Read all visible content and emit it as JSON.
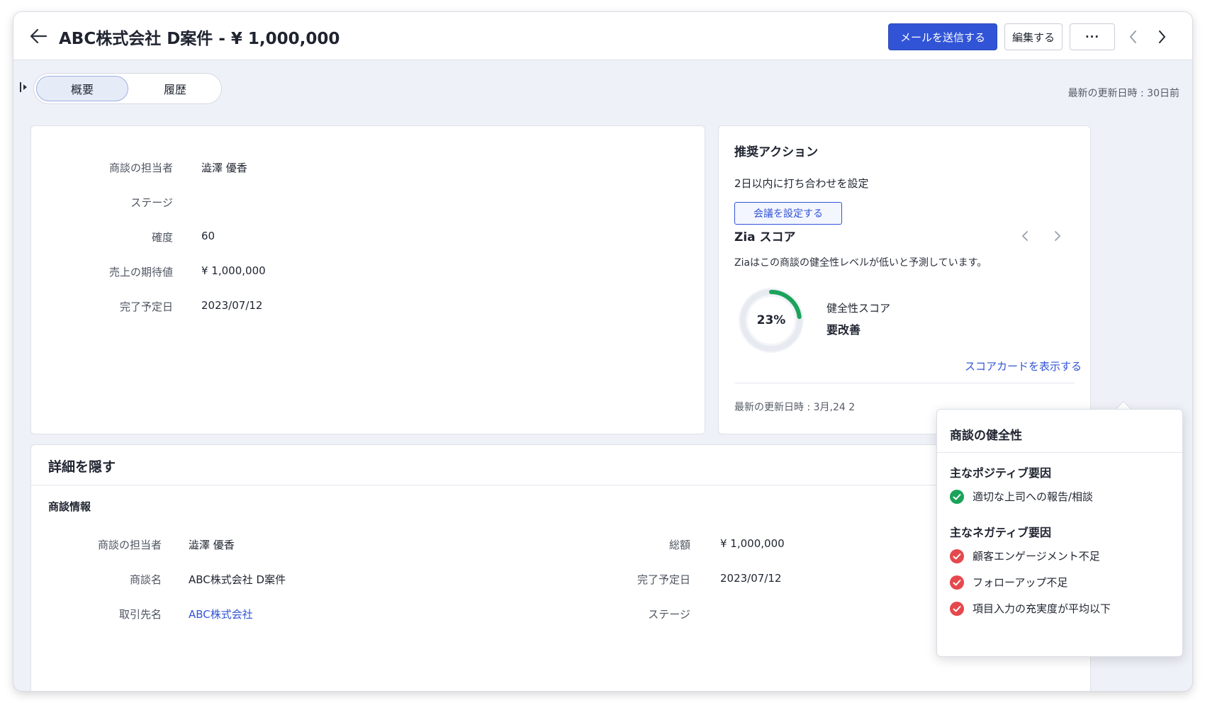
{
  "header": {
    "title": "ABC株式会社 D案件 - ¥ 1,000,000",
    "send_mail": "メールを送信する",
    "edit": "編集する",
    "more": "···"
  },
  "tabs": {
    "overview": "概要",
    "history": "履歴",
    "updated": "最新の更新日時 : 30日前"
  },
  "summary": {
    "rows": [
      {
        "label": "商談の担当者",
        "value": "澁澤 優香"
      },
      {
        "label": "ステージ",
        "value": ""
      },
      {
        "label": "確度",
        "value": "60"
      },
      {
        "label": "売上の期待値",
        "value": "¥ 1,000,000"
      },
      {
        "label": "完了予定日",
        "value": "2023/07/12"
      }
    ]
  },
  "recommend": {
    "title": "推奨アクション",
    "text": "2日以内に打ち合わせを設定",
    "button": "会議を設定する"
  },
  "zia": {
    "title": "Zia スコア",
    "description": "Ziaはこの商談の健全性レベルが低いと予測しています。",
    "score_text": "23%",
    "score": 23,
    "health_label": "健全性スコア",
    "health_value": "要改善",
    "scorecard_link": "スコアカードを表示する",
    "updated": "最新の更新日時 : 3月,24 2",
    "gauge_color": "#1aa35a"
  },
  "details": {
    "title": "詳細を隠す",
    "section": "商談情報",
    "left": [
      {
        "label": "商談の担当者",
        "value": "澁澤 優香"
      },
      {
        "label": "商談名",
        "value": "ABC株式会社 D案件"
      },
      {
        "label": "取引先名",
        "value": "ABC株式会社"
      }
    ],
    "right": [
      {
        "label": "総額",
        "value": "¥ 1,000,000"
      },
      {
        "label": "完了予定日",
        "value": "2023/07/12"
      },
      {
        "label": "ステージ",
        "value": ""
      }
    ]
  },
  "popover": {
    "title": "商談の健全性",
    "positive_heading": "主なポジティブ要因",
    "positive": [
      "適切な上司への報告/相談"
    ],
    "negative_heading": "主なネガティブ要因",
    "negative": [
      "顧客エンゲージメント不足",
      "フォローアップ不足",
      "項目入力の充実度が平均以下"
    ],
    "positive_color": "#1aa35a",
    "negative_color": "#e5484d"
  }
}
